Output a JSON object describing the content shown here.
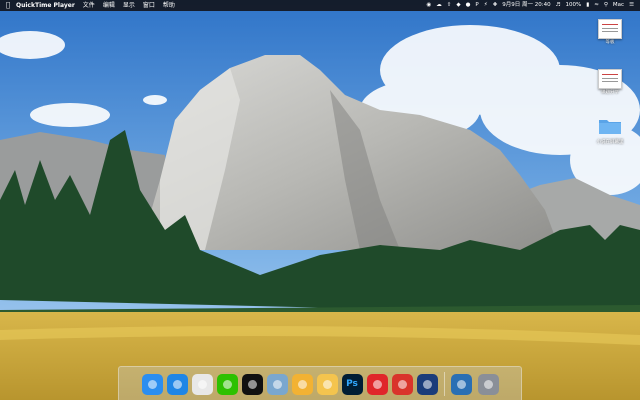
{
  "menubar": {
    "app_name": "QuickTime Player",
    "menus": [
      "文件",
      "编辑",
      "显示",
      "窗口",
      "帮助"
    ],
    "clock": "9月9日 周一 20:40",
    "battery": "100%",
    "user": "Mac"
  },
  "desktop_items": [
    {
      "label": "等板",
      "icon": "document-icon"
    },
    {
      "label": "课题分享",
      "icon": "document-icon"
    },
    {
      "label": "小说在屏幕里",
      "icon": "folder-icon"
    }
  ],
  "dock": {
    "apps": [
      {
        "name": "finder",
        "icon": "finder-icon",
        "color": "#2b8ef0"
      },
      {
        "name": "safari",
        "icon": "safari-icon",
        "color": "#1f86e6"
      },
      {
        "name": "chrome",
        "icon": "chrome-icon",
        "color": "#e8e8e8"
      },
      {
        "name": "wechat",
        "icon": "wechat-icon",
        "color": "#2dc100"
      },
      {
        "name": "qq",
        "icon": "qq-penguin-icon",
        "color": "#111111"
      },
      {
        "name": "preview",
        "icon": "preview-icon",
        "color": "#7aa7cf"
      },
      {
        "name": "notes-app",
        "icon": "notes-app-icon",
        "color": "#f2b233"
      },
      {
        "name": "stickies",
        "icon": "pen-icon",
        "color": "#f4c44e"
      },
      {
        "name": "photoshop",
        "icon": "photoshop-icon",
        "color": "#001d34",
        "text": "Ps"
      },
      {
        "name": "netease-music",
        "icon": "netease-music-icon",
        "color": "#e0262a"
      },
      {
        "name": "screen-recorder",
        "icon": "screen-recorder-icon",
        "color": "#d9342b"
      },
      {
        "name": "video-player",
        "icon": "video-player-icon",
        "color": "#1b3c7a"
      }
    ],
    "right_apps": [
      {
        "name": "quicktime",
        "icon": "quicktime-icon",
        "color": "#2a6fb4"
      },
      {
        "name": "trash",
        "icon": "trash-icon",
        "color": "#8a8f98"
      }
    ]
  }
}
